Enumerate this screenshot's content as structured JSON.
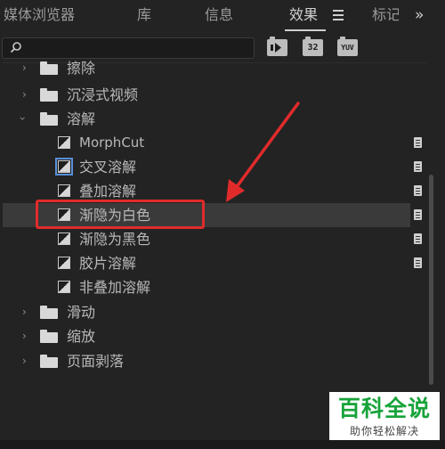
{
  "tabs": [
    {
      "label": "媒体浏览器"
    },
    {
      "label": "库"
    },
    {
      "label": "信息"
    },
    {
      "label": "效果"
    },
    {
      "label": "标记"
    }
  ],
  "overflow": "»",
  "search": {
    "value": "",
    "placeholder": ""
  },
  "filter_buttons": [
    {
      "label": "32"
    },
    {
      "label": "YUV"
    }
  ],
  "tree": [
    {
      "label": "擦除"
    },
    {
      "label": "沉浸式视频"
    },
    {
      "label": "溶解"
    },
    {
      "label": "MorphCut"
    },
    {
      "label": "交叉溶解"
    },
    {
      "label": "叠加溶解"
    },
    {
      "label": "渐隐为白色"
    },
    {
      "label": "渐隐为黑色"
    },
    {
      "label": "胶片溶解"
    },
    {
      "label": "非叠加溶解"
    },
    {
      "label": "滑动"
    },
    {
      "label": "缩放"
    },
    {
      "label": "页面剥落"
    }
  ],
  "colors": {
    "annotation": "#e12b2b",
    "watermark_green": "#17a33a",
    "selection": "#3a3a3a"
  },
  "watermark": {
    "title": "百科全说",
    "subtitle": "助你轻松解决"
  }
}
